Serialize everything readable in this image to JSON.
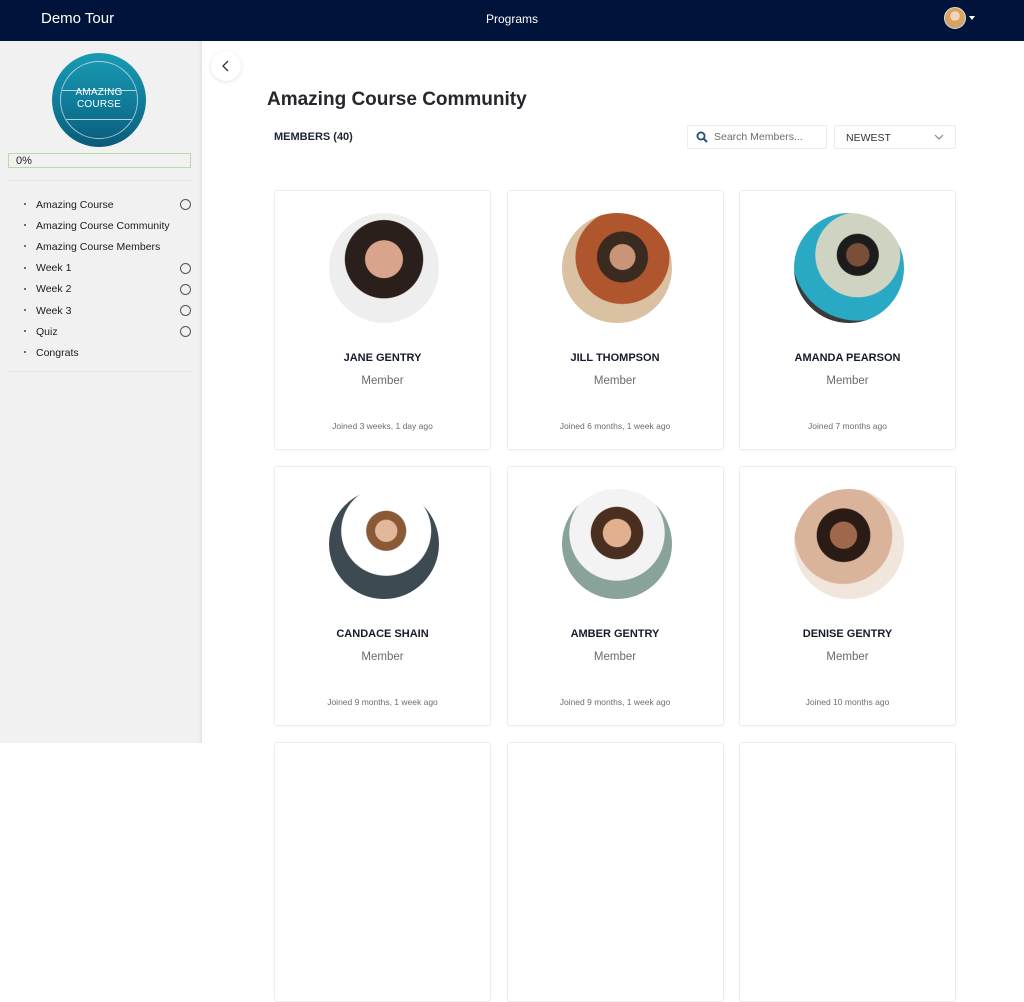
{
  "topbar": {
    "brand": "Demo Tour",
    "nav_center": "Programs",
    "user_avatar_icon": "user-avatar",
    "user_menu_caret_icon": "caret-down-icon",
    "background_color": "#00133a"
  },
  "sidebar": {
    "course_badge": {
      "line1": "AMAZING",
      "line2": "COURSE"
    },
    "progress": {
      "percent": 0,
      "label": "0%"
    },
    "items": [
      {
        "label": "Amazing Course",
        "has_status": true,
        "completed": false
      },
      {
        "label": "Amazing Course Community",
        "has_status": false
      },
      {
        "label": "Amazing Course Members",
        "has_status": false
      },
      {
        "label": "Week 1",
        "has_status": true,
        "completed": false
      },
      {
        "label": "Week 2",
        "has_status": true,
        "completed": false
      },
      {
        "label": "Week 3",
        "has_status": true,
        "completed": false
      },
      {
        "label": "Quiz",
        "has_status": true,
        "completed": false
      },
      {
        "label": "Congrats",
        "has_status": false
      }
    ]
  },
  "main": {
    "back_icon": "chevron-left-icon",
    "title": "Amazing Course Community",
    "members_label": "MEMBERS (40)",
    "search": {
      "placeholder": "Search Members...",
      "value": "",
      "icon": "search-icon"
    },
    "sort": {
      "selected": "NEWEST",
      "icon": "chevron-down-icon"
    },
    "members": [
      {
        "name": "JANE GENTRY",
        "role": "Member",
        "joined": "Joined 3 weeks, 1 day ago"
      },
      {
        "name": "JILL THOMPSON",
        "role": "Member",
        "joined": "Joined 6 months, 1 week ago"
      },
      {
        "name": "AMANDA PEARSON",
        "role": "Member",
        "joined": "Joined 7 months ago"
      },
      {
        "name": "CANDACE SHAIN",
        "role": "Member",
        "joined": "Joined 9 months, 1 week ago"
      },
      {
        "name": "AMBER GENTRY",
        "role": "Member",
        "joined": "Joined 9 months, 1 week ago"
      },
      {
        "name": "DENISE GENTRY",
        "role": "Member",
        "joined": "Joined 10 months ago"
      }
    ]
  }
}
